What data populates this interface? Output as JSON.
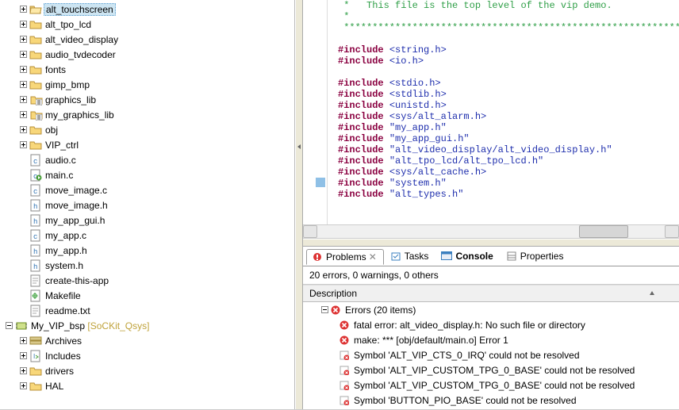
{
  "explorer": {
    "items": [
      {
        "kind": "folder-open",
        "label": "alt_touchscreen",
        "selected": true
      },
      {
        "kind": "folder",
        "label": "alt_tpo_lcd"
      },
      {
        "kind": "folder",
        "label": "alt_video_display"
      },
      {
        "kind": "folder",
        "label": "audio_tvdecoder"
      },
      {
        "kind": "folder",
        "label": "fonts"
      },
      {
        "kind": "folder",
        "label": "gimp_bmp"
      },
      {
        "kind": "folder-lib",
        "label": "graphics_lib"
      },
      {
        "kind": "folder-lib",
        "label": "my_graphics_lib"
      },
      {
        "kind": "folder",
        "label": "obj"
      },
      {
        "kind": "folder",
        "label": "VIP_ctrl"
      },
      {
        "kind": "c",
        "label": "audio.c"
      },
      {
        "kind": "c-main",
        "label": "main.c"
      },
      {
        "kind": "c",
        "label": "move_image.c"
      },
      {
        "kind": "h",
        "label": "move_image.h"
      },
      {
        "kind": "h",
        "label": "my_app_gui.h"
      },
      {
        "kind": "c",
        "label": "my_app.c"
      },
      {
        "kind": "h",
        "label": "my_app.h"
      },
      {
        "kind": "h",
        "label": "system.h"
      },
      {
        "kind": "txt",
        "label": "create-this-app"
      },
      {
        "kind": "mk",
        "label": "Makefile"
      },
      {
        "kind": "txt",
        "label": "readme.txt"
      }
    ],
    "bsp": {
      "label": "My_VIP_bsp",
      "suffix": "[SoCKit_Qsys]"
    },
    "bsp_children": [
      {
        "kind": "arch",
        "label": "Archives"
      },
      {
        "kind": "inc",
        "label": "Includes"
      },
      {
        "kind": "folder",
        "label": "drivers"
      },
      {
        "kind": "folder",
        "label": "HAL"
      }
    ]
  },
  "editor": {
    "lines": [
      {
        "cls": "cmt",
        "text": " *   This file is the top level of the vip demo."
      },
      {
        "cls": "cmt",
        "text": " *"
      },
      {
        "cls": "cmt",
        "text": " ******************************************************************"
      },
      {
        "cls": "",
        "text": ""
      },
      {
        "cls": "inc",
        "kw": "#include",
        "arg": "<string.h>"
      },
      {
        "cls": "inc",
        "kw": "#include",
        "arg": "<io.h>"
      },
      {
        "cls": "",
        "text": ""
      },
      {
        "cls": "inc",
        "kw": "#include",
        "arg": "<stdio.h>"
      },
      {
        "cls": "inc",
        "kw": "#include",
        "arg": "<stdlib.h>"
      },
      {
        "cls": "inc",
        "kw": "#include",
        "arg": "<unistd.h>"
      },
      {
        "cls": "inc",
        "kw": "#include",
        "arg": "<sys/alt_alarm.h>"
      },
      {
        "cls": "inc",
        "kw": "#include",
        "arg": "\"my_app.h\""
      },
      {
        "cls": "inc",
        "kw": "#include",
        "arg": "\"my_app_gui.h\""
      },
      {
        "cls": "inc",
        "kw": "#include",
        "arg": "\"alt_video_display/alt_video_display.h\""
      },
      {
        "cls": "inc",
        "kw": "#include",
        "arg": "\"alt_tpo_lcd/alt_tpo_lcd.h\""
      },
      {
        "cls": "inc",
        "kw": "#include",
        "arg": "<sys/alt_cache.h>"
      },
      {
        "cls": "inc",
        "kw": "#include",
        "arg": "\"system.h\"",
        "mark": true
      },
      {
        "cls": "inc",
        "kw": "#include",
        "arg": "\"alt_types.h\""
      }
    ]
  },
  "tabs": {
    "problems": "Problems",
    "tasks": "Tasks",
    "console": "Console",
    "properties": "Properties"
  },
  "status": "20 errors, 0 warnings, 0 others",
  "colheader": "Description",
  "problems": {
    "group": "Errors (20 items)",
    "items": [
      {
        "icon": "error",
        "text": "fatal error: alt_video_display.h: No such file or directory"
      },
      {
        "icon": "error",
        "text": "make: *** [obj/default/main.o] Error 1"
      },
      {
        "icon": "warn",
        "text": "Symbol 'ALT_VIP_CTS_0_IRQ' could not be resolved"
      },
      {
        "icon": "warn",
        "text": "Symbol 'ALT_VIP_CUSTOM_TPG_0_BASE' could not be resolved"
      },
      {
        "icon": "warn",
        "text": "Symbol 'ALT_VIP_CUSTOM_TPG_0_BASE' could not be resolved"
      },
      {
        "icon": "warn",
        "text": "Symbol 'BUTTON_PIO_BASE' could not be resolved"
      }
    ]
  }
}
